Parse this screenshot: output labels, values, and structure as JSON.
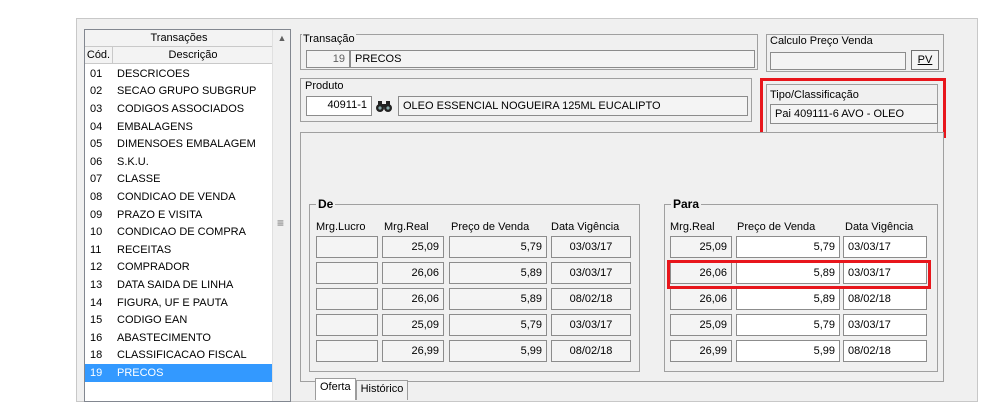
{
  "transacoes_list": {
    "title": "Transações",
    "col_code": "Cód.",
    "col_desc": "Descrição",
    "items": [
      {
        "code": "01",
        "desc": "DESCRICOES"
      },
      {
        "code": "02",
        "desc": "SECAO GRUPO SUBGRUP"
      },
      {
        "code": "03",
        "desc": "CODIGOS ASSOCIADOS"
      },
      {
        "code": "04",
        "desc": "EMBALAGENS"
      },
      {
        "code": "05",
        "desc": "DIMENSOES EMBALAGEM"
      },
      {
        "code": "06",
        "desc": "S.K.U."
      },
      {
        "code": "07",
        "desc": "CLASSE"
      },
      {
        "code": "08",
        "desc": "CONDICAO DE VENDA"
      },
      {
        "code": "09",
        "desc": "PRAZO E VISITA"
      },
      {
        "code": "10",
        "desc": "CONDICAO DE COMPRA"
      },
      {
        "code": "11",
        "desc": "RECEITAS"
      },
      {
        "code": "12",
        "desc": "COMPRADOR"
      },
      {
        "code": "13",
        "desc": "DATA SAIDA DE LINHA"
      },
      {
        "code": "14",
        "desc": "FIGURA, UF E PAUTA"
      },
      {
        "code": "15",
        "desc": "CODIGO EAN"
      },
      {
        "code": "16",
        "desc": "ABASTECIMENTO"
      },
      {
        "code": "18",
        "desc": "CLASSIFICACAO FISCAL"
      },
      {
        "code": "19",
        "desc": "PRECOS"
      }
    ],
    "selected_code": "19"
  },
  "transacao": {
    "label": "Transação",
    "number": "19",
    "name": "PRECOS"
  },
  "calculo": {
    "label": "Calculo Preço Venda",
    "button": "PV"
  },
  "produto": {
    "label": "Produto",
    "code": "40911-1",
    "desc": "OLEO ESSENCIAL NOGUEIRA 125ML EUCALIPTO"
  },
  "tipo": {
    "label": "Tipo/Classificação",
    "value": "Pai 409111-6 AVO - OLEO"
  },
  "de": {
    "label": "De",
    "headers": [
      "Mrg.Lucro",
      "Mrg.Real",
      "Preço de Venda",
      "Data Vigência"
    ],
    "rows": [
      {
        "lucro": "",
        "real": "25,09",
        "preco": "5,79",
        "data": "03/03/17"
      },
      {
        "lucro": "",
        "real": "26,06",
        "preco": "5,89",
        "data": "03/03/17"
      },
      {
        "lucro": "",
        "real": "26,06",
        "preco": "5,89",
        "data": "08/02/18"
      },
      {
        "lucro": "",
        "real": "25,09",
        "preco": "5,79",
        "data": "03/03/17"
      },
      {
        "lucro": "",
        "real": "26,99",
        "preco": "5,99",
        "data": "08/02/18"
      }
    ]
  },
  "para": {
    "label": "Para",
    "headers": [
      "Mrg.Real",
      "Preço de Venda",
      "Data Vigência"
    ],
    "rows": [
      {
        "real": "25,09",
        "preco": "5,79",
        "data": "03/03/17"
      },
      {
        "real": "26,06",
        "preco": "5,89",
        "data": "03/03/17"
      },
      {
        "real": "26,06",
        "preco": "5,89",
        "data": "08/02/18"
      },
      {
        "real": "25,09",
        "preco": "5,79",
        "data": "03/03/17"
      },
      {
        "real": "26,99",
        "preco": "5,99",
        "data": "08/02/18"
      }
    ]
  },
  "tabs": [
    "Oferta",
    "Histórico"
  ],
  "colors": {
    "highlight": "#e8161c",
    "selection": "#3399ff"
  }
}
